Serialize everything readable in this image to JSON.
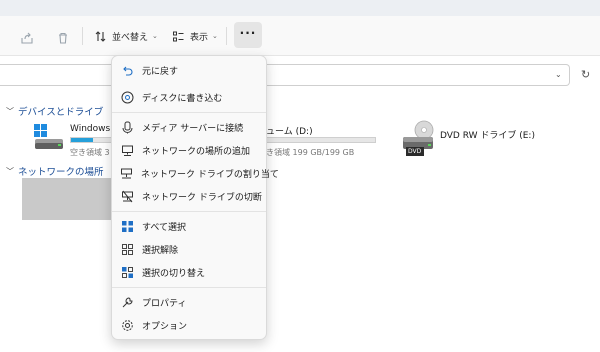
{
  "toolbar": {
    "sort_label": "並べ替え",
    "view_label": "表示",
    "more_label": "···"
  },
  "sections": {
    "devices": "デバイスとドライブ",
    "network": "ネットワークの場所"
  },
  "drives": [
    {
      "name": "Windows (",
      "free": "空き領域 3",
      "usage_fraction": 0.55
    },
    {
      "name": "ューム (D:)",
      "free": "き領域 199 GB/199 GB",
      "usage_fraction": 0.0
    },
    {
      "name": "DVD RW ドライブ (E:)",
      "disc_label": "DVD"
    }
  ],
  "menu": {
    "items": [
      {
        "label": "元に戻す",
        "icon": "undo-icon"
      },
      {
        "label": "ディスクに書き込む",
        "icon": "disc-burn-icon"
      },
      {
        "label": "メディア サーバーに接続",
        "icon": "media-server-icon"
      },
      {
        "label": "ネットワークの場所の追加",
        "icon": "network-location-icon"
      },
      {
        "label": "ネットワーク ドライブの割り当て",
        "icon": "map-drive-icon"
      },
      {
        "label": "ネットワーク ドライブの切断",
        "icon": "disconnect-drive-icon"
      },
      {
        "label": "すべて選択",
        "icon": "select-all-icon"
      },
      {
        "label": "選択解除",
        "icon": "select-none-icon"
      },
      {
        "label": "選択の切り替え",
        "icon": "invert-selection-icon"
      },
      {
        "label": "プロパティ",
        "icon": "properties-icon"
      },
      {
        "label": "オプション",
        "icon": "options-gear-icon"
      }
    ]
  },
  "colors": {
    "accent": "#26a0da",
    "section_title": "#1c4e96",
    "icon_blue": "#1f6fc5"
  }
}
